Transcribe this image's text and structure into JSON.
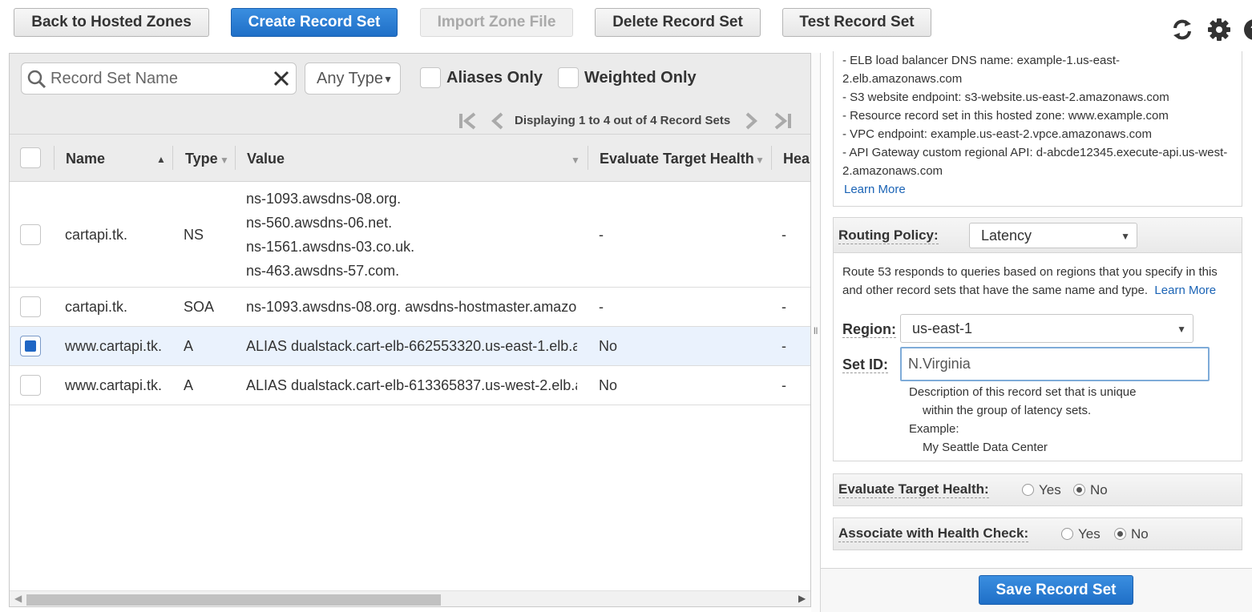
{
  "toolbar": {
    "back": "Back to Hosted Zones",
    "create": "Create Record Set",
    "import": "Import Zone File",
    "delete": "Delete Record Set",
    "test": "Test Record Set"
  },
  "top_icons": [
    "refresh-icon",
    "gear-icon",
    "help-icon"
  ],
  "filters": {
    "search_placeholder": "Record Set Name",
    "type_value": "Any Type",
    "aliases_only": "Aliases Only",
    "weighted_only": "Weighted Only"
  },
  "pager": {
    "text": "Displaying 1 to 4 out of 4 Record Sets"
  },
  "table": {
    "headers": {
      "name": "Name",
      "type": "Type",
      "value": "Value",
      "eval": "Evaluate Target Health",
      "health": "Hea"
    },
    "rows": [
      {
        "name": "cartapi.tk.",
        "type": "NS",
        "values": [
          "ns-1093.awsdns-08.org.",
          "ns-560.awsdns-06.net.",
          "ns-1561.awsdns-03.co.uk.",
          "ns-463.awsdns-57.com."
        ],
        "eval": "-",
        "health": "-",
        "checked": false
      },
      {
        "name": "cartapi.tk.",
        "type": "SOA",
        "values": [
          "ns-1093.awsdns-08.org. awsdns-hostmaster.amazon"
        ],
        "eval": "-",
        "health": "-",
        "checked": false
      },
      {
        "name": "www.cartapi.tk.",
        "type": "A",
        "values": [
          "ALIAS dualstack.cart-elb-662553320.us-east-1.elb.a"
        ],
        "eval": "No",
        "health": "-",
        "checked": true
      },
      {
        "name": "www.cartapi.tk.",
        "type": "A",
        "values": [
          "ALIAS dualstack.cart-elb-613365837.us-west-2.elb.a"
        ],
        "eval": "No",
        "health": "-",
        "checked": false
      }
    ]
  },
  "info": {
    "lines": [
      "-  ELB load balancer DNS name: example-1.us-east-",
      "2.elb.amazonaws.com",
      "-  S3 website endpoint: s3-website.us-east-2.amazonaws.com",
      "-  Resource record set in this hosted zone: www.example.com",
      "-  VPC endpoint: example.us-east-2.vpce.amazonaws.com",
      "-  API Gateway custom regional API: d-abcde12345.execute-api.us-west-",
      "2.amazonaws.com"
    ],
    "learn_more": "Learn More"
  },
  "routing": {
    "label": "Routing Policy:",
    "value": "Latency",
    "desc_line1": "Route 53 responds to queries based on regions that you specify in this",
    "desc_line2": "and other record sets that have the same name and type.",
    "learn_more": "Learn More",
    "region_label": "Region:",
    "region_value": "us-east-1",
    "setid_label": "Set ID:",
    "setid_value": "N.Virginia",
    "hint1": "Description of this record set that is unique",
    "hint2": "within the group of latency sets.",
    "hint3": "Example:",
    "hint4": "My Seattle Data Center"
  },
  "eval_health": {
    "label": "Evaluate Target Health:",
    "yes": "Yes",
    "no": "No",
    "selected": "No"
  },
  "assoc_health": {
    "label": "Associate with Health Check:",
    "yes": "Yes",
    "no": "No",
    "selected": "No"
  },
  "save": "Save Record Set"
}
